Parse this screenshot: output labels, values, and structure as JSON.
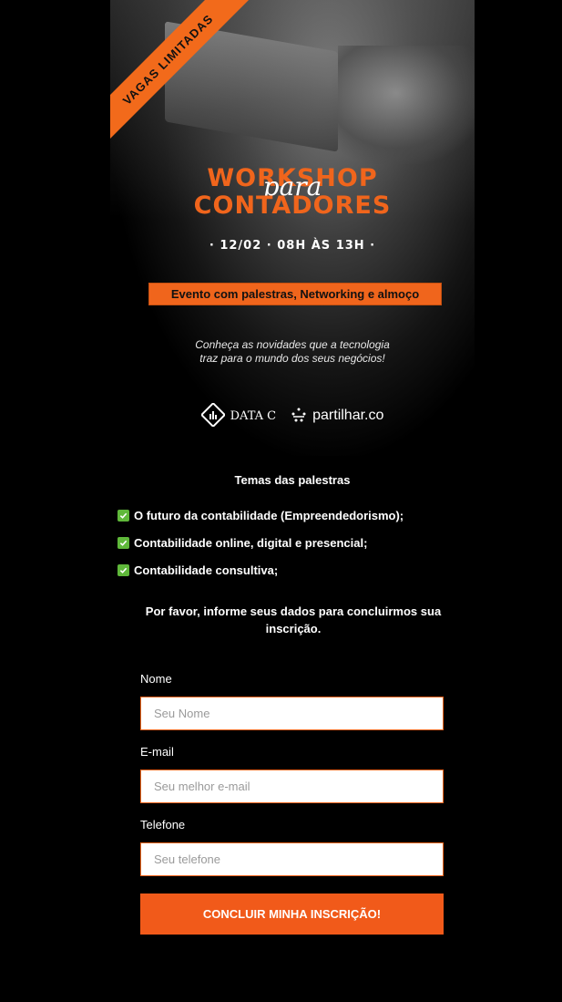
{
  "banner": {
    "ribbon": "VAGAS LIMITADAS",
    "title_line1": "WORKSHOP",
    "title_script": "para",
    "title_line2": "CONTADORES",
    "date_line": "· 12/02 · 08H ÀS 13H ·",
    "event_tag": "Evento com palestras, Networking e almoço",
    "tagline_line1": "Conheça as novidades que a tecnologia",
    "tagline_line2": "traz para o mundo dos seus negócios!",
    "logo_datac": "DATA C",
    "logo_partilhar": "partilhar.co"
  },
  "topics": {
    "title": "Temas das palestras",
    "items": [
      "O futuro da contabilidade (Empreendedorismo);",
      "Contabilidade online, digital e presencial;",
      "Contabilidade consultiva;"
    ]
  },
  "form": {
    "intro": "Por favor, informe seus dados para concluirmos sua inscrição.",
    "name_label": "Nome",
    "name_placeholder": "Seu Nome",
    "email_label": "E-mail",
    "email_placeholder": "Seu melhor e-mail",
    "phone_label": "Telefone",
    "phone_placeholder": "Seu telefone",
    "submit_label": "CONCLUIR MINHA INSCRIÇÃO!"
  },
  "colors": {
    "accent": "#f15a1a",
    "check": "#5fb83a",
    "background": "#000000"
  },
  "icons": [
    "check-icon",
    "datac-logo-icon",
    "partilhar-logo-icon"
  ]
}
